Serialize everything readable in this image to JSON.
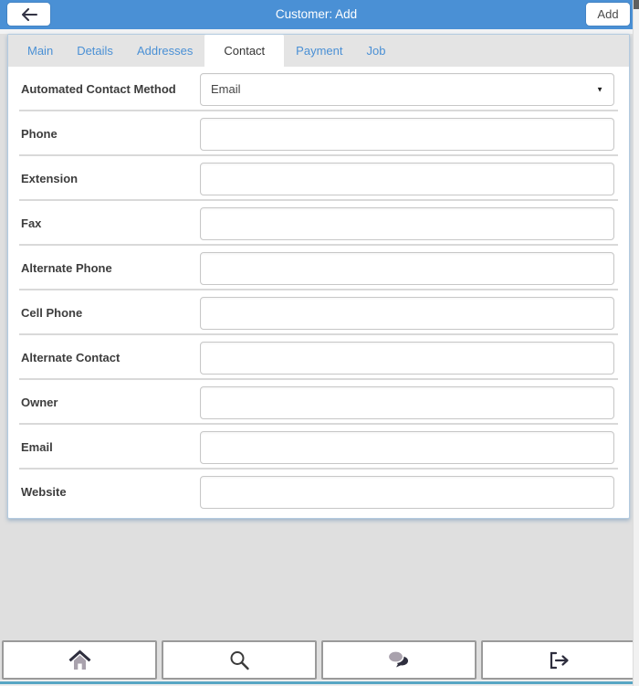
{
  "header": {
    "title": "Customer: Add",
    "add_button": "Add"
  },
  "tabs": {
    "items": [
      {
        "label": "Main",
        "active": false
      },
      {
        "label": "Details",
        "active": false
      },
      {
        "label": "Addresses",
        "active": false
      },
      {
        "label": "Contact",
        "active": true
      },
      {
        "label": "Payment",
        "active": false
      },
      {
        "label": "Job",
        "active": false
      }
    ]
  },
  "form": {
    "rows": [
      {
        "label": "Automated Contact Method",
        "control": "select",
        "value": "Email",
        "caret": "▼"
      },
      {
        "label": "Phone",
        "control": "text",
        "value": ""
      },
      {
        "label": "Extension",
        "control": "text",
        "value": ""
      },
      {
        "label": "Fax",
        "control": "text",
        "value": ""
      },
      {
        "label": "Alternate Phone",
        "control": "text",
        "value": ""
      },
      {
        "label": "Cell Phone",
        "control": "text",
        "value": ""
      },
      {
        "label": "Alternate Contact",
        "control": "text",
        "value": ""
      },
      {
        "label": "Owner",
        "control": "text",
        "value": ""
      },
      {
        "label": "Email",
        "control": "text",
        "value": ""
      },
      {
        "label": "Website",
        "control": "text",
        "value": ""
      }
    ]
  },
  "toolbar": {
    "buttons": [
      {
        "icon": "home-icon"
      },
      {
        "icon": "search-icon"
      },
      {
        "icon": "chat-icon"
      },
      {
        "icon": "logout-icon"
      }
    ]
  },
  "colors": {
    "header_bg": "#4a90d5",
    "tab_text": "#4a90d5",
    "accent_line": "#58a6c4",
    "icon_dark": "#2e2e3e",
    "icon_gray": "#a9a2ad"
  }
}
